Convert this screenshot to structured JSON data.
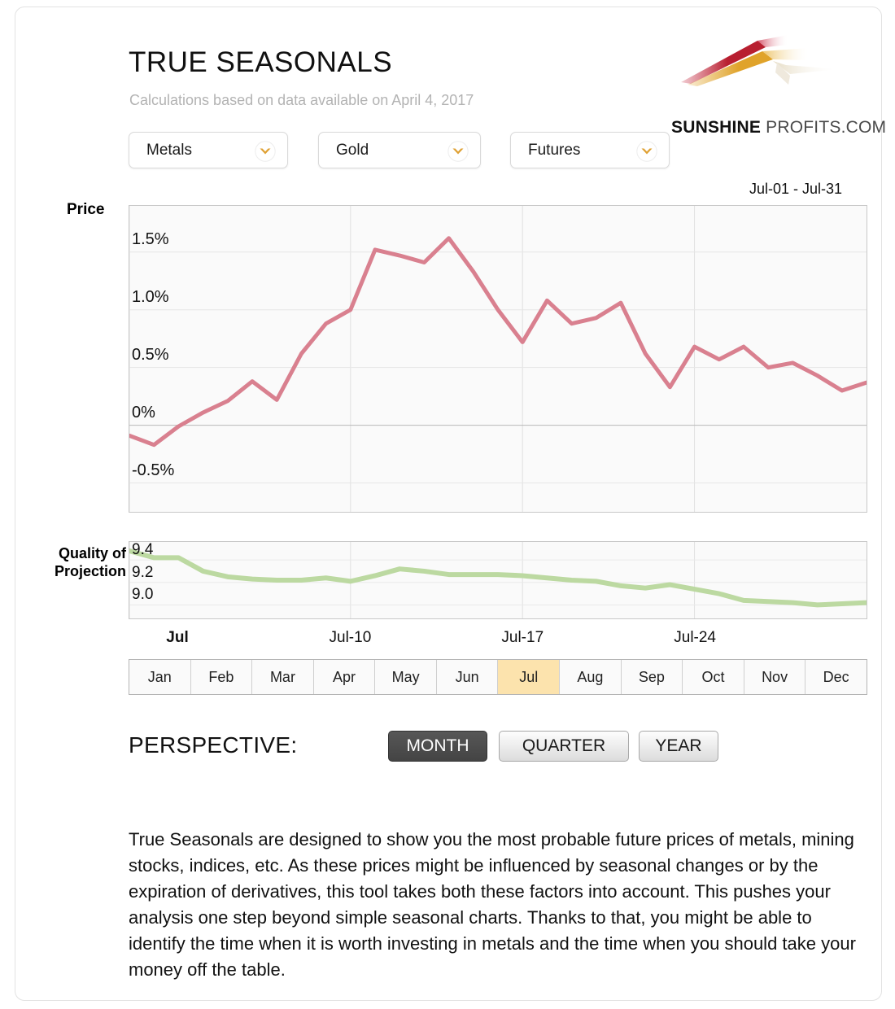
{
  "header": {
    "title": "TRUE SEASONALS",
    "subtitle": "Calculations based on data available on April 4, 2017"
  },
  "logo": {
    "name_bold": "SUNSHINE",
    "name_normal": " PROFITS.COM",
    "colors": {
      "red": "#b81f30",
      "gold": "#e0a32a",
      "cream": "#efe3c3"
    }
  },
  "selectors": [
    {
      "name": "category-select",
      "value": "Metals",
      "icon": "chevron-down-icon"
    },
    {
      "name": "instrument-select",
      "value": "Gold",
      "icon": "chevron-down-icon"
    },
    {
      "name": "contract-select",
      "value": "Futures",
      "icon": "chevron-down-icon"
    }
  ],
  "chart": {
    "range_label": "Jul-01 - Jul-31",
    "price_axis_title": "Price",
    "quality_axis_title": "Quality of\nProjection",
    "quality_axis_title_line1": "Quality of",
    "quality_axis_title_line2": "Projection"
  },
  "months": {
    "items": [
      "Jan",
      "Feb",
      "Mar",
      "Apr",
      "May",
      "Jun",
      "Jul",
      "Aug",
      "Sep",
      "Oct",
      "Nov",
      "Dec"
    ],
    "active": "Jul",
    "active_color": "#fce3ad"
  },
  "perspective": {
    "label": "PERSPECTIVE:",
    "options": [
      "MONTH",
      "QUARTER",
      "YEAR"
    ],
    "active": "MONTH"
  },
  "description": "True Seasonals are designed to show you the most probable future prices of metals, mining stocks, indices, etc. As these prices might be influenced by seasonal changes or by the expiration of derivatives, this tool takes both these factors into account. This pushes your analysis one step beyond simple seasonal charts. Thanks to that, you might be able to identify the time when it is worth investing in metals and the time when you should take your money off the table.",
  "chart_data": [
    {
      "type": "line",
      "name": "price-seasonal-chart",
      "title": "Price",
      "subtitle": "Jul-01 - Jul-31",
      "xlabel": "",
      "ylabel": "Price",
      "grid": true,
      "legend": "none",
      "line_color": "#d9808f",
      "plot_bg": "#fafafa",
      "ylim": [
        -0.75,
        1.9
      ],
      "yticks": [
        1.5,
        1.0,
        0.5,
        0,
        -0.5
      ],
      "ytick_labels": [
        "1.5%",
        "1.0%",
        "0.5%",
        "0%",
        "-0.5%"
      ],
      "xticks": [
        1,
        10,
        17,
        24
      ],
      "xtick_labels": [
        "Jul",
        "Jul-10",
        "Jul-17",
        "Jul-24"
      ],
      "x": [
        1,
        2,
        3,
        4,
        5,
        6,
        7,
        8,
        9,
        10,
        11,
        12,
        13,
        14,
        15,
        16,
        17,
        18,
        19,
        20,
        21,
        22,
        23,
        24,
        25,
        26,
        27,
        28,
        29,
        30,
        31
      ],
      "values": [
        -0.09,
        -0.17,
        -0.01,
        0.11,
        0.21,
        0.38,
        0.22,
        0.62,
        0.88,
        1.0,
        1.52,
        1.47,
        1.41,
        1.62,
        1.33,
        1.0,
        0.72,
        1.08,
        0.88,
        0.93,
        1.06,
        0.62,
        0.33,
        0.68,
        0.57,
        0.68,
        0.5,
        0.54,
        0.43,
        0.3,
        0.37
      ]
    },
    {
      "type": "line",
      "name": "quality-of-projection-chart",
      "title": "Quality of Projection",
      "xlabel": "",
      "ylabel": "Quality of Projection",
      "grid": true,
      "legend": "none",
      "line_color": "#bcd9a1",
      "plot_bg": "#fafafa",
      "ylim": [
        8.88,
        9.56
      ],
      "yticks": [
        9.4,
        9.2,
        9.0
      ],
      "ytick_labels": [
        "9.4",
        "9.2",
        "9.0"
      ],
      "xticks": [
        1,
        10,
        17,
        24
      ],
      "xtick_labels": [
        "Jul",
        "Jul-10",
        "Jul-17",
        "Jul-24"
      ],
      "x": [
        1,
        2,
        3,
        4,
        5,
        6,
        7,
        8,
        9,
        10,
        11,
        12,
        13,
        14,
        15,
        16,
        17,
        18,
        19,
        20,
        21,
        22,
        23,
        24,
        25,
        26,
        27,
        28,
        29,
        30,
        31
      ],
      "values": [
        9.48,
        9.42,
        9.42,
        9.3,
        9.25,
        9.23,
        9.22,
        9.22,
        9.24,
        9.21,
        9.26,
        9.32,
        9.3,
        9.27,
        9.27,
        9.27,
        9.26,
        9.24,
        9.22,
        9.21,
        9.17,
        9.15,
        9.18,
        9.14,
        9.1,
        9.04,
        9.03,
        9.02,
        9.0,
        9.01,
        9.02
      ]
    }
  ]
}
